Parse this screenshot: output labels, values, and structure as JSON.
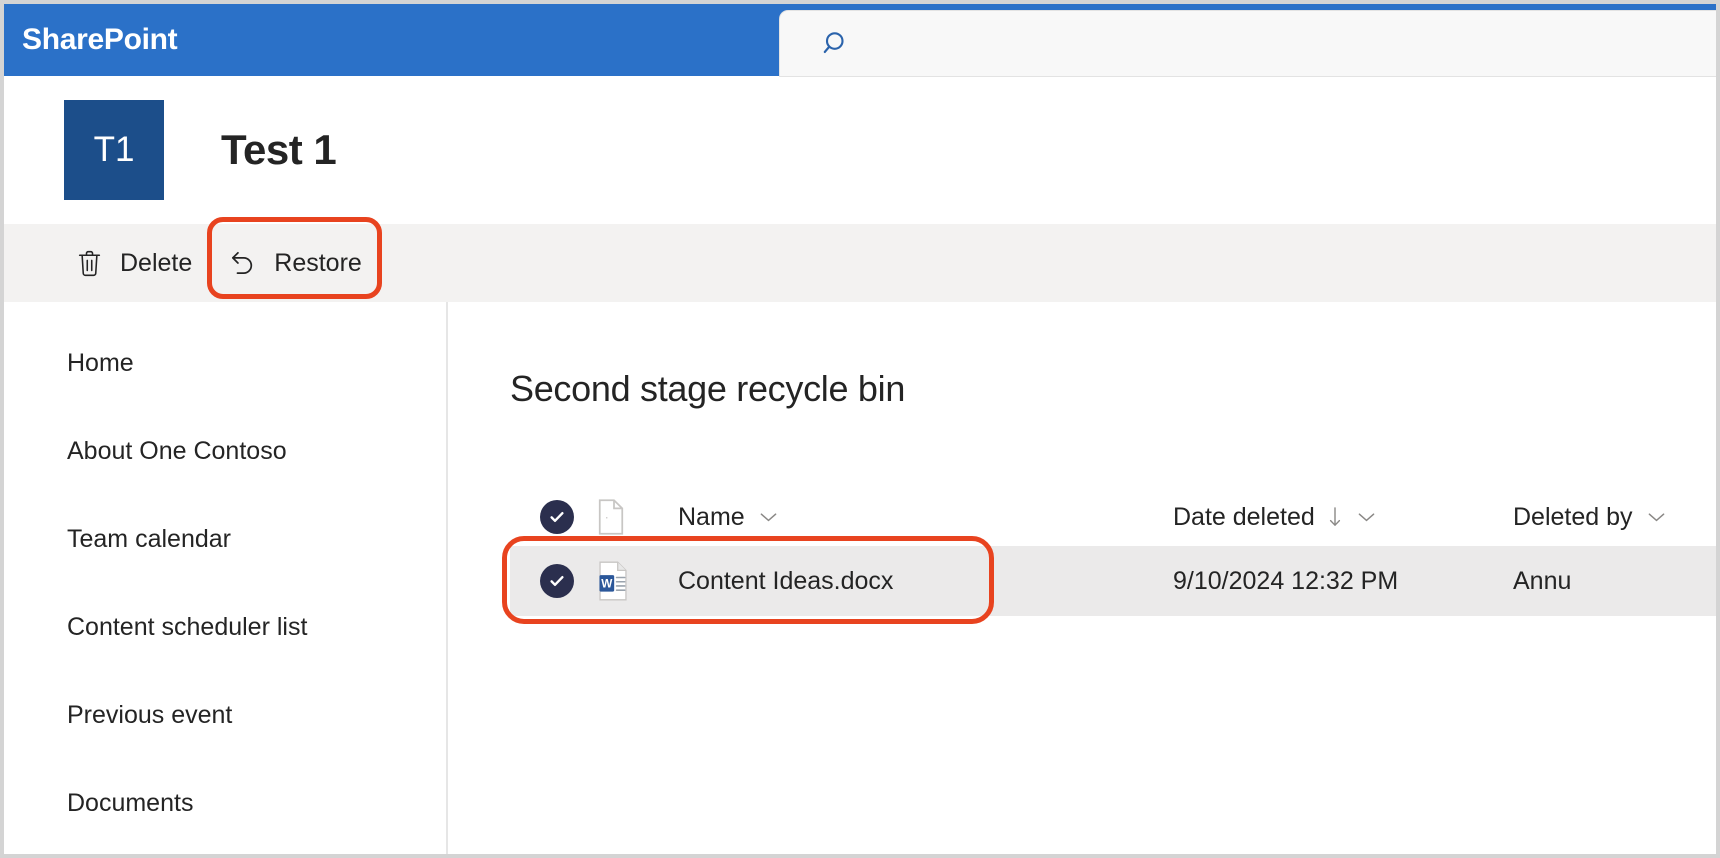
{
  "suitebar": {
    "brand": "SharePoint",
    "search_placeholder": "",
    "search_value": "",
    "search_icon": "search-icon",
    "background": "#2b71c8"
  },
  "site_header": {
    "logo_initials": "T1",
    "logo_color": "#1c4e8a",
    "title": "Test 1"
  },
  "commandbar": {
    "background": "#f3f2f1",
    "buttons": [
      {
        "label": "Delete",
        "icon": "trash-icon"
      },
      {
        "label": "Restore",
        "icon": "undo-arrow-icon"
      }
    ],
    "annotation_color": "#e8431f",
    "annotated_button": "Restore"
  },
  "sidebar": {
    "items": [
      {
        "label": "Home"
      },
      {
        "label": "About One Contoso"
      },
      {
        "label": "Team calendar"
      },
      {
        "label": "Content scheduler list"
      },
      {
        "label": "Previous event"
      },
      {
        "label": "Documents"
      }
    ]
  },
  "main": {
    "page_title": "Second stage recycle bin",
    "table": {
      "select_all_icon": "check-circle-filled-icon",
      "file_type_header_icon": "document-icon",
      "columns": [
        {
          "label": "Name",
          "chevron": "chevron-down-icon",
          "sort": ""
        },
        {
          "label": "Date deleted",
          "chevron": "chevron-down-icon",
          "sort": "arrow-down-icon"
        },
        {
          "label": "Deleted by",
          "chevron": "chevron-down-icon",
          "sort": ""
        }
      ],
      "rows": [
        {
          "selected": true,
          "check_icon": "check-circle-filled-icon",
          "file_icon": "word-document-icon",
          "name": "Content Ideas.docx",
          "date_deleted": "9/10/2024 12:32 PM",
          "deleted_by": "Annu",
          "row_highlight": "#ebeaea",
          "annotated": true
        }
      ]
    }
  }
}
